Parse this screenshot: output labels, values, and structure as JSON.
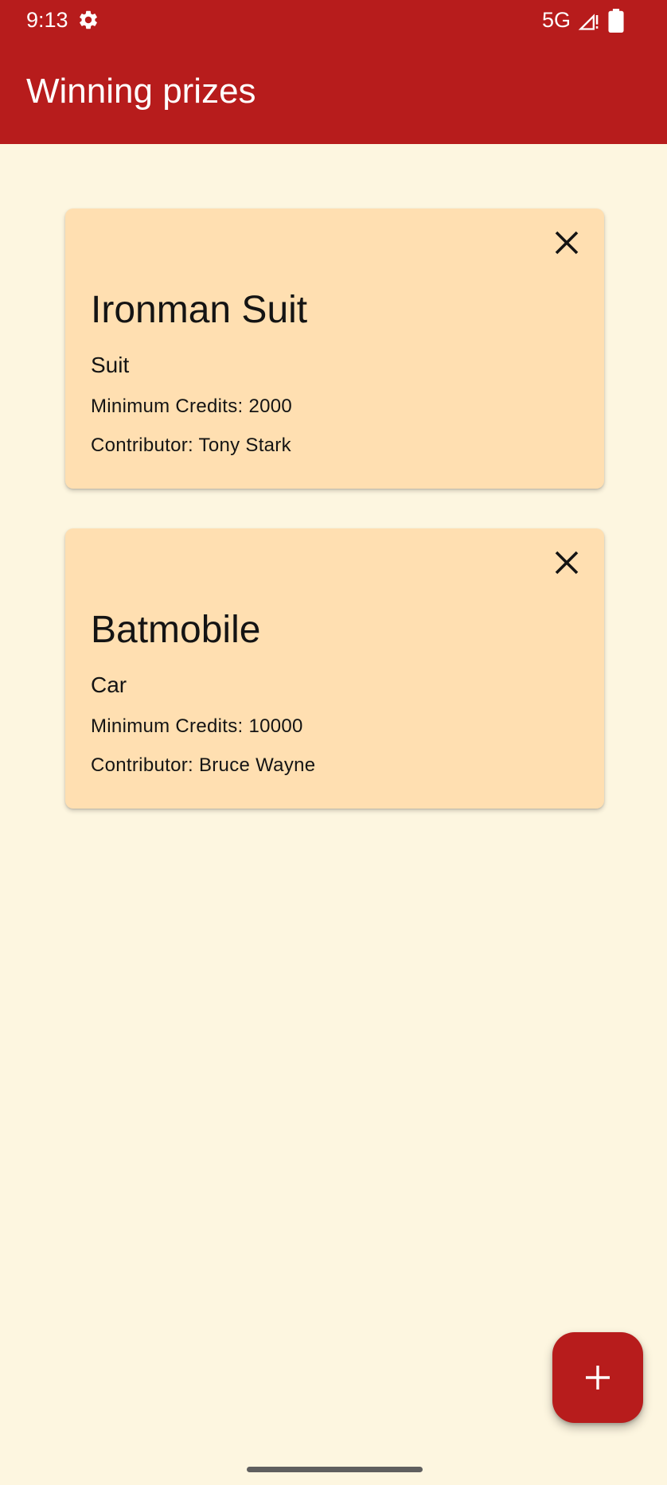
{
  "status_bar": {
    "time": "9:13",
    "network": "5G",
    "icons": [
      "gear-icon",
      "signal-icon",
      "battery-icon"
    ]
  },
  "app_bar": {
    "title": "Winning prizes"
  },
  "prizes": [
    {
      "name": "Ironman Suit",
      "category": "Suit",
      "credits": "Minimum Credits: 2000",
      "contributor": "Contributor: Tony Stark"
    },
    {
      "name": "Batmobile",
      "category": "Car",
      "credits": "Minimum Credits: 10000",
      "contributor": "Contributor: Bruce Wayne"
    }
  ],
  "fab": {
    "icon": "plus-icon"
  },
  "colors": {
    "primary": "#B71C1C",
    "background": "#FDF6E0",
    "card": "#FFDFB1",
    "on_primary": "#FFFFFF"
  }
}
